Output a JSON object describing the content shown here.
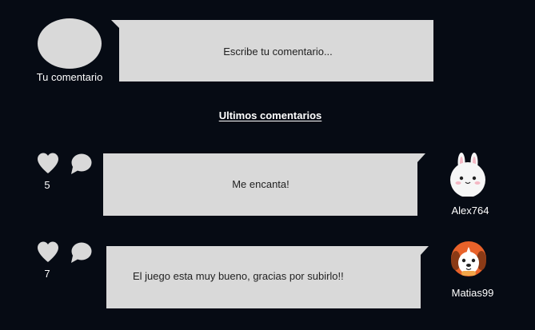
{
  "composer": {
    "avatar_caption": "Tu comentario",
    "input_placeholder": "Escribe tu comentario..."
  },
  "section": {
    "heading": "Ultimos comentarios"
  },
  "comments": [
    {
      "text": "Me encanta!",
      "likes": "5",
      "username": "Alex764",
      "avatar": "bunny-avatar-icon"
    },
    {
      "text": "El juego esta muy bueno, gracias por subirlo!!",
      "likes": "7",
      "username": "Matias99",
      "avatar": "dog-avatar-icon"
    }
  ],
  "colors": {
    "background": "#060b14",
    "bubble": "#d9d9d9",
    "icon": "#d9d9d9",
    "text_light": "#ffffff",
    "text_dark": "#222222"
  }
}
